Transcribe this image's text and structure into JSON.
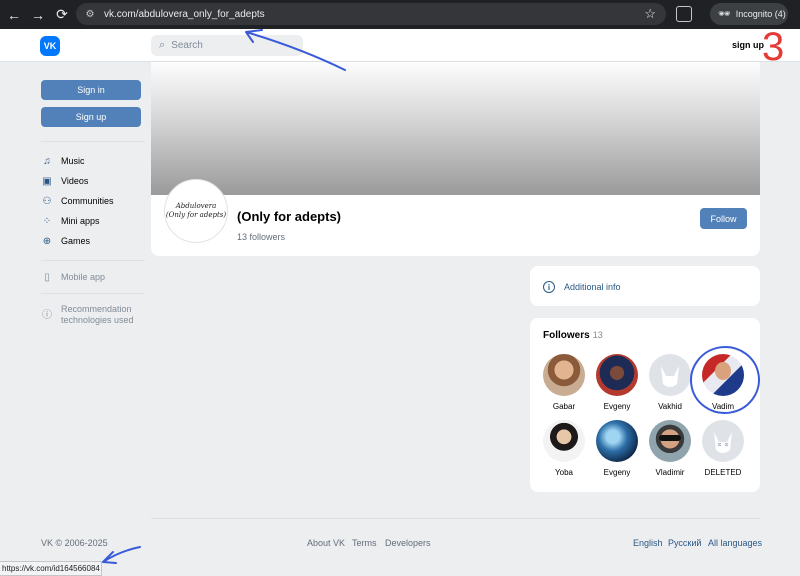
{
  "browser": {
    "url": "vk.com/abdulovera_only_for_adepts",
    "incognito_label": "Incognito (4)",
    "status_url": "https://vk.com/id164566084"
  },
  "header": {
    "logo_text": "VK",
    "search_placeholder": "Search",
    "signup_label": "sign up"
  },
  "sidebar": {
    "signin_label": "Sign in",
    "signup_label": "Sign up",
    "items": [
      {
        "label": "Music",
        "icon": "music-icon"
      },
      {
        "label": "Videos",
        "icon": "video-icon"
      },
      {
        "label": "Communities",
        "icon": "communities-icon"
      },
      {
        "label": "Mini apps",
        "icon": "mini-apps-icon"
      },
      {
        "label": "Games",
        "icon": "gamepad-icon"
      }
    ],
    "mobile_app_label": "Mobile app",
    "recommendation_label_1": "Recommendation",
    "recommendation_label_2": "technologies used"
  },
  "profile": {
    "avatar_text_1": "Abdulovera",
    "avatar_text_2": "(Only for adepts)",
    "name": "(Only for adepts)",
    "followers_text": "13 followers",
    "follow_label": "Follow"
  },
  "info": {
    "additional_info_label": "Additional info"
  },
  "followers": {
    "title": "Followers",
    "count": "13",
    "list": [
      {
        "name": "Gabar"
      },
      {
        "name": "Evgeny"
      },
      {
        "name": "Vakhid"
      },
      {
        "name": "Vadim"
      },
      {
        "name": "Yoba"
      },
      {
        "name": "Evgeny"
      },
      {
        "name": "Vladimir"
      },
      {
        "name": "DELETED"
      }
    ]
  },
  "footer": {
    "copyright": "VK © 2006-2025",
    "about": "About VK",
    "terms": "Terms",
    "developers": "Developers",
    "lang_english": "English",
    "lang_russian": "Русский",
    "all_languages": "All languages"
  },
  "annotations": {
    "number": "3"
  },
  "colors": {
    "accent": "#5181b8",
    "vk_blue": "#0077ff",
    "link": "#2a5885",
    "annotation_blue": "#3a5bd9",
    "annotation_red": "#e53935"
  }
}
